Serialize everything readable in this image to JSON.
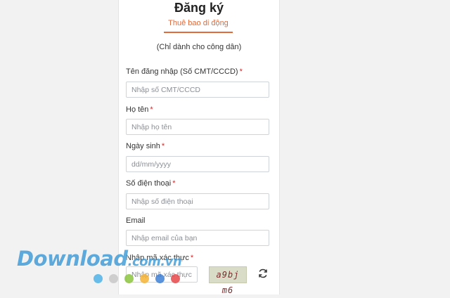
{
  "form": {
    "title": "Đăng ký",
    "tab_label": "Thuê bao di động",
    "subtitle": "(Chỉ dành cho công dân)",
    "required_mark": "*",
    "fields": [
      {
        "label": "Tên đăng nhập (Số CMT/CCCD)",
        "required": true,
        "placeholder": "Nhập số CMT/CCCD"
      },
      {
        "label": "Họ tên",
        "required": true,
        "placeholder": "Nhập họ tên"
      },
      {
        "label": "Ngày sinh",
        "required": true,
        "placeholder": "dd/mm/yyyy"
      },
      {
        "label": "Số điện thoại",
        "required": true,
        "placeholder": "Nhập số điện thoại"
      },
      {
        "label": "Email",
        "required": false,
        "placeholder": "Nhập email của bạn"
      }
    ],
    "captcha": {
      "label": "Nhập mã xác thực",
      "placeholder": "Nhập mã xác thực",
      "code": "a9bj m6",
      "refresh_icon": "refresh-icon"
    }
  },
  "watermark": {
    "text": "Download",
    "suffix": ".com.vn",
    "dot_colors": [
      "#4fb3e8",
      "#c8c8c8",
      "#8cc63f",
      "#f5b335",
      "#3d7fd6",
      "#e8464a"
    ]
  },
  "colors": {
    "accent": "#e06a3a",
    "required": "#e02020",
    "watermark": "#3d9ad6"
  }
}
